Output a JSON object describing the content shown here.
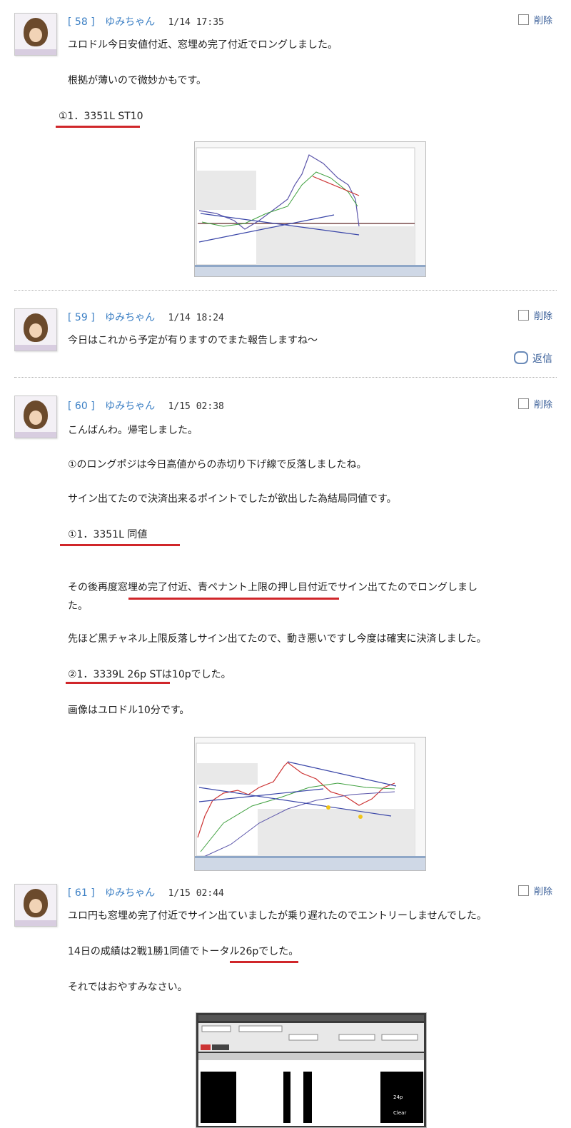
{
  "posts": [
    {
      "number": "58",
      "name": "ゆみちゃん",
      "date": "1/14  17:35",
      "delete_label": "削除",
      "lines": [
        "ユロドル今日安値付近、窓埋め完了付近でロングしました。",
        "根拠が薄いので微妙かもです。",
        "①1．3351L  ST10"
      ]
    },
    {
      "number": "59",
      "name": "ゆみちゃん",
      "date": "1/14  18:24",
      "delete_label": "削除",
      "lines": [
        "今日はこれから予定が有りますのでまた報告しますね～"
      ],
      "reply_label": "返信"
    },
    {
      "number": "60",
      "name": "ゆみちゃん",
      "date": "1/15  02:38",
      "delete_label": "削除",
      "lines": [
        "こんばんわ。帰宅しました。",
        "①のロングポジは今日高値からの赤切り下げ線で反落しましたね。",
        "サイン出てたので決済出来るポイントでしたが欲出した為結局同値です。",
        "①1．3351L  同値",
        "その後再度窓埋め完了付近、青ペナント上限の押し目付近でサイン出てたのでロングしまし",
        "た。",
        "先ほど黒チャネル上限反落しサイン出てたので、動き悪いですし今度は確実に決済しました。",
        "②1．3339L  26p  STは10pでした。",
        "画像はユロドル10分です。"
      ]
    },
    {
      "number": "61",
      "name": "ゆみちゃん",
      "date": "1/15  02:44",
      "delete_label": "削除",
      "lines": [
        "ユロ円も窓埋め完了付近でサイン出ていましたが乗り遅れたのでエントリーしませんでした。",
        "14日の成績は2戦1勝1同値でトータル26pでした。",
        "それではおやすみなさい。"
      ],
      "table_values": [
        "24p",
        "Clear"
      ]
    }
  ],
  "colors": {
    "link": "#3b7fc4",
    "underline": "#d0262a",
    "text": "#222222"
  }
}
